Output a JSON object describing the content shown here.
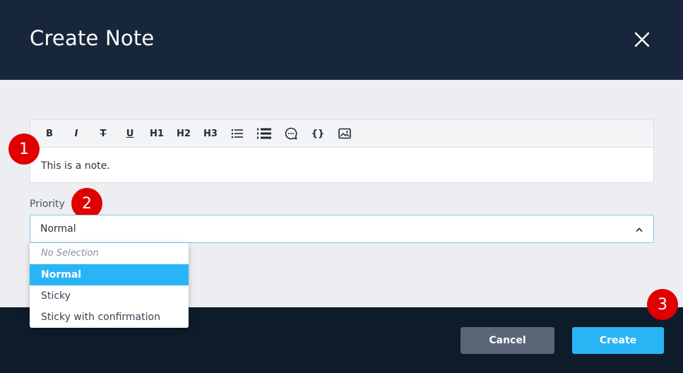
{
  "dialog": {
    "title": "Create Note"
  },
  "editor": {
    "toolbar": [
      {
        "icon": "bold-icon",
        "label": "B"
      },
      {
        "icon": "italic-icon",
        "label": "I"
      },
      {
        "icon": "strikethrough-icon",
        "label": "T"
      },
      {
        "icon": "underline-icon",
        "label": "U"
      },
      {
        "icon": "heading1-icon",
        "label": "H1"
      },
      {
        "icon": "heading2-icon",
        "label": "H2"
      },
      {
        "icon": "heading3-icon",
        "label": "H3"
      },
      {
        "icon": "bullet-list-icon",
        "label": ""
      },
      {
        "icon": "numbered-list-icon",
        "label": ""
      },
      {
        "icon": "comment-icon",
        "label": ""
      },
      {
        "icon": "code-braces-icon",
        "label": "{}"
      },
      {
        "icon": "image-icon",
        "label": ""
      }
    ],
    "content": "This is a note."
  },
  "priority": {
    "label": "Priority",
    "value": "Normal",
    "options": [
      "No Selection",
      "Normal",
      "Sticky",
      "Sticky with confirmation"
    ],
    "placeholder_option": "No Selection"
  },
  "badges": [
    "1",
    "2",
    "3"
  ],
  "footer": {
    "cancel_label": "Cancel",
    "create_label": "Create"
  },
  "colors": {
    "header_bg": "#17263a",
    "footer_bg": "#0d1b2b",
    "accent": "#29b4f6",
    "cancel_bg": "#5a6678",
    "badge": "#e00000"
  }
}
